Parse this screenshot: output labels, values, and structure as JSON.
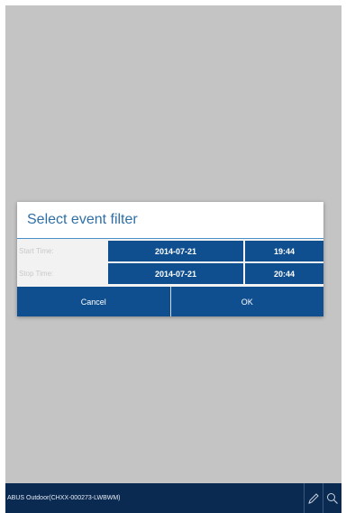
{
  "dialog": {
    "title": "Select event filter",
    "start_time_label": "Start Time:",
    "start_date": "2014-07-21",
    "start_time": "19:44",
    "stop_time_label": "Stop Time:",
    "stop_date": "2014-07-21",
    "stop_time": "20:44",
    "cancel_label": "Cancel",
    "ok_label": "OK"
  },
  "bottom_bar": {
    "device_name": "ABUS Outdoor(CHXX-000273-LWBWM)",
    "icons": [
      "pencil-icon",
      "search-icon"
    ]
  },
  "colors": {
    "background": "#c4c4c4",
    "accent": "#0f4f8f",
    "title_text": "#2f6fa6",
    "bottom_bar": "#0b2a52"
  }
}
